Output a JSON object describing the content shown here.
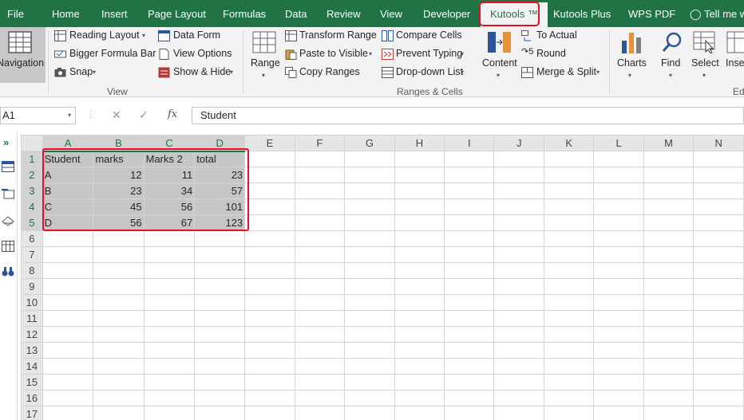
{
  "tabs": [
    {
      "label": "File"
    },
    {
      "label": "Home"
    },
    {
      "label": "Insert"
    },
    {
      "label": "Page Layout"
    },
    {
      "label": "Formulas"
    },
    {
      "label": "Data"
    },
    {
      "label": "Review"
    },
    {
      "label": "View"
    },
    {
      "label": "Developer"
    },
    {
      "label": "Kutools ™",
      "active": true
    },
    {
      "label": "Kutools Plus"
    },
    {
      "label": "WPS PDF"
    },
    {
      "label": "Tell me w"
    }
  ],
  "ribbon": {
    "navigation": "Navigation",
    "view_group": {
      "reading_layout": "Reading Layout",
      "bigger_formula_bar": "Bigger Formula Bar",
      "snap": "Snap",
      "data_form": "Data Form",
      "view_options": "View Options",
      "show_hide": "Show & Hide",
      "label": "View"
    },
    "ranges_group": {
      "range": "Range",
      "transform_range": "Transform Range",
      "paste_to_visible": "Paste to Visible",
      "copy_ranges": "Copy Ranges",
      "compare_cells": "Compare Cells",
      "prevent_typing": "Prevent Typing",
      "dropdown_list": "Drop-down List",
      "content": "Content",
      "to_actual": "To Actual",
      "round": "Round",
      "merge_split": "Merge & Split",
      "label": "Ranges & Cells"
    },
    "charts": "Charts",
    "find": "Find",
    "select": "Select",
    "insert": "Inse",
    "edit_label": "Ed"
  },
  "formula_bar": {
    "name_box": "A1",
    "cancel": "✕",
    "enter": "✓",
    "fx": "fx",
    "value": "Student"
  },
  "sheet": {
    "columns": [
      "A",
      "B",
      "C",
      "D",
      "E",
      "F",
      "G",
      "H",
      "I",
      "J",
      "K",
      "L",
      "M",
      "N"
    ],
    "rows": [
      "1",
      "2",
      "3",
      "4",
      "5",
      "6",
      "7",
      "8",
      "9",
      "10",
      "11",
      "12",
      "13",
      "14",
      "15",
      "16",
      "17"
    ],
    "cells": [
      [
        "Student",
        "marks",
        "Marks 2",
        "total"
      ],
      [
        "A",
        "12",
        "11",
        "23"
      ],
      [
        "B",
        "23",
        "34",
        "57"
      ],
      [
        "C",
        "45",
        "56",
        "101"
      ],
      [
        "D",
        "56",
        "67",
        "123"
      ]
    ]
  },
  "colors": {
    "excel_green": "#217346",
    "highlight_red": "#e81123",
    "selection_fill": "#c6c6c6"
  }
}
